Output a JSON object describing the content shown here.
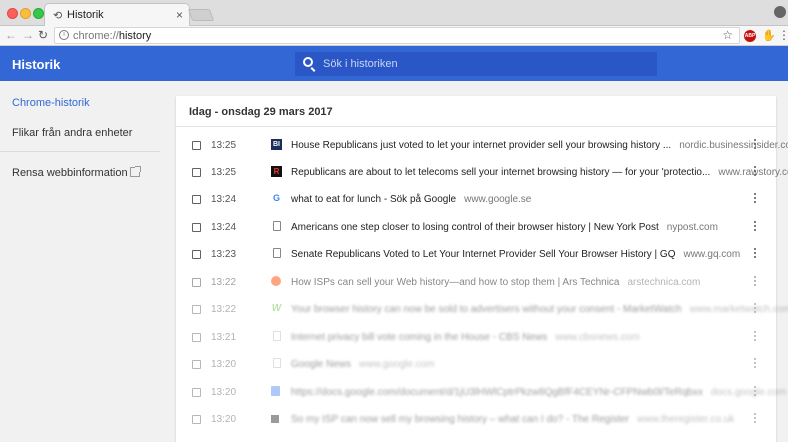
{
  "tab": {
    "title": "Historik",
    "close": "×"
  },
  "toolbar": {
    "url_scheme": "chrome://",
    "url_path": "history",
    "abp_label": "ABP"
  },
  "header": {
    "title": "Historik",
    "search_placeholder": "Sök i historiken"
  },
  "sidebar": {
    "items": [
      {
        "label": "Chrome-historik"
      },
      {
        "label": "Flikar från andra enheter"
      },
      {
        "label": "Rensa webbinformation"
      }
    ]
  },
  "history": {
    "date_heading": "Idag - onsdag 29 mars 2017",
    "rows": [
      {
        "time": "13:25",
        "title": "House Republicans just voted to let your internet provider sell your browsing history ...",
        "domain": "nordic.businessinsider.com",
        "icon": "businessinsider-icon"
      },
      {
        "time": "13:25",
        "title": "Republicans are about to let telecoms sell your internet browsing history — for your 'protectio...",
        "domain": "www.rawstory.com",
        "icon": "rawstory-icon"
      },
      {
        "time": "13:24",
        "title": "what to eat for lunch - Sök på Google",
        "domain": "www.google.se",
        "icon": "google-icon"
      },
      {
        "time": "13:24",
        "title": "Americans one step closer to losing control of their browser history | New York Post",
        "domain": "nypost.com",
        "icon": "page-icon"
      },
      {
        "time": "13:23",
        "title": "Senate Republicans Voted to Let Your Internet Provider Sell Your Browser History | GQ",
        "domain": "www.gq.com",
        "icon": "page-icon"
      },
      {
        "time": "13:22",
        "title": "How ISPs can sell your Web history—and how to stop them | Ars Technica",
        "domain": "arstechnica.com",
        "icon": "arstechnica-icon"
      },
      {
        "time": "13:22",
        "title": "Your browser history can now be sold to advertisers without your consent - MarketWatch",
        "domain": "www.marketwatch.com",
        "icon": "marketwatch-icon"
      },
      {
        "time": "13:21",
        "title": "Internet privacy bill vote coming in the House - CBS News",
        "domain": "www.cbsnews.com",
        "icon": "page-icon"
      },
      {
        "time": "13:20",
        "title": "Google News",
        "domain": "www.google.com",
        "icon": "page-icon"
      },
      {
        "time": "13:20",
        "title": "https://docs.google.com/document/d/1jU3lHWlCptrPkzw8QgBfF4CEYNr-CFPNwb0l/TeRqbxx",
        "domain": "docs.google.com",
        "icon": "google-docs-icon"
      },
      {
        "time": "13:20",
        "title": "So my ISP can now sell my browsing history – what can I do? - The Register",
        "domain": "www.theregister.co.uk",
        "icon": "theregister-icon"
      }
    ]
  }
}
